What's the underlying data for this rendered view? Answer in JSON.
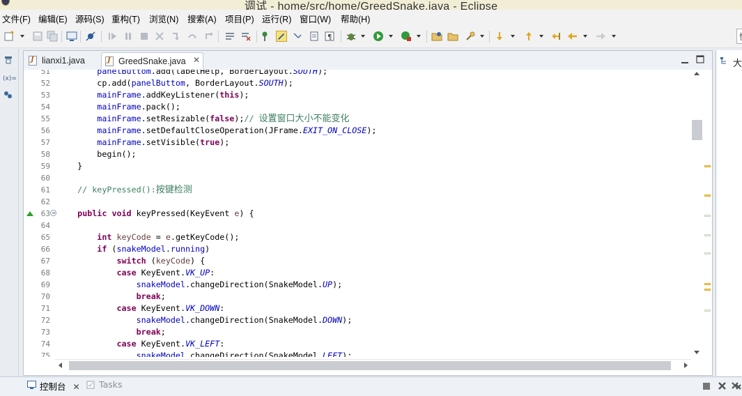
{
  "window": {
    "title": "调试 - home/src/home/GreedSnake.java - Eclipse"
  },
  "menu": [
    {
      "label": "文件(F)"
    },
    {
      "label": "编辑(E)"
    },
    {
      "label": "源码(S)"
    },
    {
      "label": "重构(T)"
    },
    {
      "label": "浏览(N)"
    },
    {
      "label": "搜索(A)"
    },
    {
      "label": "项目(P)"
    },
    {
      "label": "运行(R)"
    },
    {
      "label": "窗口(W)"
    },
    {
      "label": "帮助(H)"
    }
  ],
  "quick_access": {
    "text": "快"
  },
  "left_trim": {
    "icons": [
      "restore-icon",
      "variables-icon",
      "breakpoints-icon"
    ],
    "variables_label": "(x)="
  },
  "editor": {
    "tabs": [
      {
        "label": "lianxi1.java",
        "active": false
      },
      {
        "label": "GreedSnake.java",
        "active": true
      }
    ],
    "close_glyph": "✕"
  },
  "code": {
    "override_line": "63",
    "lines": [
      {
        "n": "51",
        "segs": [
          {
            "t": "        "
          },
          {
            "t": "panelButtom",
            "c": "fld"
          },
          {
            "t": ".add(labelHelp, BorderLayout."
          },
          {
            "t": "SOUTH",
            "c": "sfld"
          },
          {
            "t": ");"
          }
        ]
      },
      {
        "n": "52",
        "segs": [
          {
            "t": "        cp.add("
          },
          {
            "t": "panelButtom",
            "c": "fld"
          },
          {
            "t": ", BorderLayout."
          },
          {
            "t": "SOUTH",
            "c": "sfld"
          },
          {
            "t": ");"
          }
        ]
      },
      {
        "n": "53",
        "segs": [
          {
            "t": "        "
          },
          {
            "t": "mainFrame",
            "c": "fld"
          },
          {
            "t": ".addKeyListener("
          },
          {
            "t": "this",
            "c": "kw"
          },
          {
            "t": ");"
          }
        ]
      },
      {
        "n": "54",
        "segs": [
          {
            "t": "        "
          },
          {
            "t": "mainFrame",
            "c": "fld"
          },
          {
            "t": ".pack();"
          }
        ]
      },
      {
        "n": "55",
        "segs": [
          {
            "t": "        "
          },
          {
            "t": "mainFrame",
            "c": "fld"
          },
          {
            "t": ".setResizable("
          },
          {
            "t": "false",
            "c": "kw"
          },
          {
            "t": ");"
          },
          {
            "t": "// ",
            "c": "cm"
          },
          {
            "t": "设置窗口大小不能变化",
            "c": "cmcn"
          }
        ]
      },
      {
        "n": "56",
        "segs": [
          {
            "t": "        "
          },
          {
            "t": "mainFrame",
            "c": "fld"
          },
          {
            "t": ".setDefaultCloseOperation(JFrame."
          },
          {
            "t": "EXIT_ON_CLOSE",
            "c": "sfld"
          },
          {
            "t": ");"
          }
        ]
      },
      {
        "n": "57",
        "segs": [
          {
            "t": "        "
          },
          {
            "t": "mainFrame",
            "c": "fld"
          },
          {
            "t": ".setVisible("
          },
          {
            "t": "true",
            "c": "kw"
          },
          {
            "t": ");"
          }
        ]
      },
      {
        "n": "58",
        "segs": [
          {
            "t": "        begin();"
          }
        ]
      },
      {
        "n": "59",
        "segs": [
          {
            "t": "    }"
          }
        ]
      },
      {
        "n": "60",
        "segs": [
          {
            "t": ""
          }
        ]
      },
      {
        "n": "61",
        "segs": [
          {
            "t": "    "
          },
          {
            "t": "// keyPressed():",
            "c": "cm"
          },
          {
            "t": "按键检测",
            "c": "cmcn"
          }
        ]
      },
      {
        "n": "62",
        "segs": [
          {
            "t": ""
          }
        ]
      },
      {
        "n": "63",
        "segs": [
          {
            "t": "    "
          },
          {
            "t": "public",
            "c": "kw"
          },
          {
            "t": " "
          },
          {
            "t": "void",
            "c": "kw"
          },
          {
            "t": " keyPressed(KeyEvent "
          },
          {
            "t": "e",
            "c": "var"
          },
          {
            "t": ") {"
          }
        ]
      },
      {
        "n": "64",
        "segs": [
          {
            "t": ""
          }
        ]
      },
      {
        "n": "65",
        "segs": [
          {
            "t": "        "
          },
          {
            "t": "int",
            "c": "kw"
          },
          {
            "t": " "
          },
          {
            "t": "keyCode",
            "c": "var"
          },
          {
            "t": " = "
          },
          {
            "t": "e",
            "c": "var"
          },
          {
            "t": ".getKeyCode();"
          }
        ]
      },
      {
        "n": "66",
        "segs": [
          {
            "t": "        "
          },
          {
            "t": "if",
            "c": "kw"
          },
          {
            "t": " ("
          },
          {
            "t": "snakeModel",
            "c": "fld"
          },
          {
            "t": "."
          },
          {
            "t": "running",
            "c": "fld"
          },
          {
            "t": ")"
          }
        ]
      },
      {
        "n": "67",
        "segs": [
          {
            "t": "            "
          },
          {
            "t": "switch",
            "c": "kw"
          },
          {
            "t": " ("
          },
          {
            "t": "keyCode",
            "c": "var"
          },
          {
            "t": ") {"
          }
        ]
      },
      {
        "n": "68",
        "segs": [
          {
            "t": "            "
          },
          {
            "t": "case",
            "c": "kw"
          },
          {
            "t": " KeyEvent."
          },
          {
            "t": "VK_UP",
            "c": "sfld"
          },
          {
            "t": ":"
          }
        ]
      },
      {
        "n": "69",
        "segs": [
          {
            "t": "                "
          },
          {
            "t": "snakeModel",
            "c": "fld"
          },
          {
            "t": ".changeDirection(SnakeModel."
          },
          {
            "t": "UP",
            "c": "sfld"
          },
          {
            "t": ");"
          }
        ]
      },
      {
        "n": "70",
        "segs": [
          {
            "t": "                "
          },
          {
            "t": "break",
            "c": "kw"
          },
          {
            "t": ";"
          }
        ]
      },
      {
        "n": "71",
        "segs": [
          {
            "t": "            "
          },
          {
            "t": "case",
            "c": "kw"
          },
          {
            "t": " KeyEvent."
          },
          {
            "t": "VK_DOWN",
            "c": "sfld"
          },
          {
            "t": ":"
          }
        ]
      },
      {
        "n": "72",
        "segs": [
          {
            "t": "                "
          },
          {
            "t": "snakeModel",
            "c": "fld"
          },
          {
            "t": ".changeDirection(SnakeModel."
          },
          {
            "t": "DOWN",
            "c": "sfld"
          },
          {
            "t": ");"
          }
        ]
      },
      {
        "n": "73",
        "segs": [
          {
            "t": "                "
          },
          {
            "t": "break",
            "c": "kw"
          },
          {
            "t": ";"
          }
        ]
      },
      {
        "n": "74",
        "segs": [
          {
            "t": "            "
          },
          {
            "t": "case",
            "c": "kw"
          },
          {
            "t": " KeyEvent."
          },
          {
            "t": "VK_LEFT",
            "c": "sfld"
          },
          {
            "t": ":"
          }
        ]
      },
      {
        "n": "75",
        "segs": [
          {
            "t": "                "
          },
          {
            "t": "snakeModel",
            "c": "fld"
          },
          {
            "t": ".changeDirection(SnakeModel."
          },
          {
            "t": "LEFT",
            "c": "sfld"
          },
          {
            "t": ");"
          }
        ]
      }
    ]
  },
  "syntax_colors": {
    "keyword": "#7f0055",
    "field": "#0000c0",
    "comment": "#3f7f5f",
    "local_variable": "#6a3e3e"
  },
  "right_panel": {
    "label": "大"
  },
  "bottom_panel": {
    "tabs": [
      {
        "label": "控制台",
        "active": true,
        "close": "✕"
      },
      {
        "label": "Tasks",
        "active": false
      }
    ]
  }
}
